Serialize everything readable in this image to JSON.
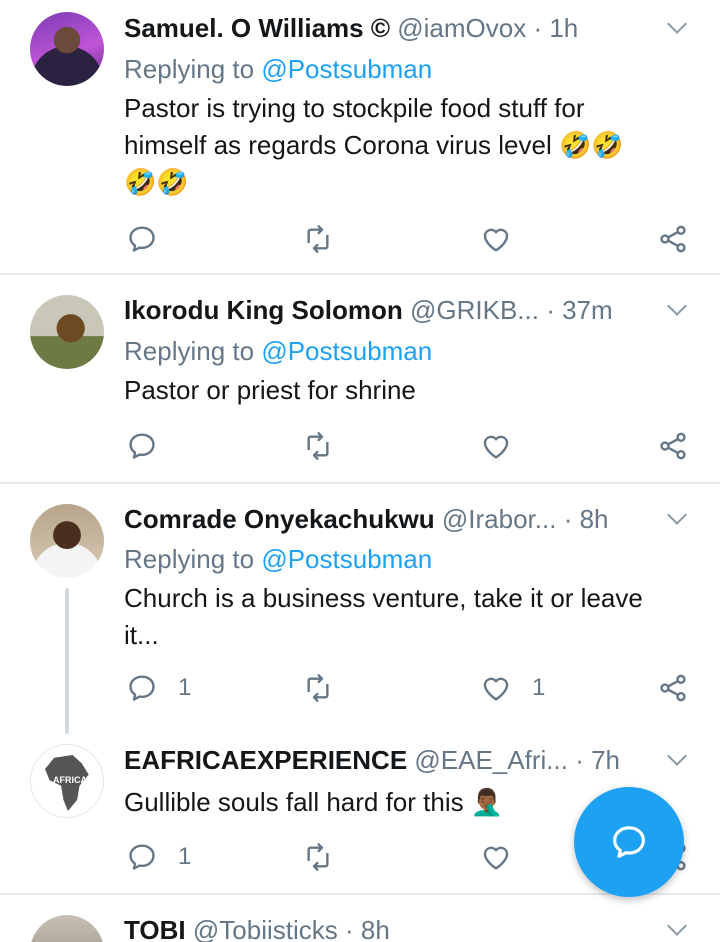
{
  "tweets": [
    {
      "name": "Samuel. O Williams ©",
      "handle": "@iamOvox",
      "time": "· 1h",
      "reply_prefix": "Replying to",
      "reply_to": "@Postsubman",
      "text": "Pastor is trying to stockpile food stuff for himself as regards Corona virus level 🤣🤣\n🤣🤣",
      "replies": "",
      "likes": ""
    },
    {
      "name": "Ikorodu King Solomon",
      "handle": "@GRIKB...",
      "time": "· 37m",
      "reply_prefix": "Replying to",
      "reply_to": "@Postsubman",
      "text": "Pastor or priest for shrine",
      "replies": "",
      "likes": ""
    },
    {
      "name": "Comrade Onyekachukwu",
      "handle": "@Irabor...",
      "time": "· 8h",
      "reply_prefix": "Replying to",
      "reply_to": "@Postsubman",
      "text": "Church is a business venture, take it or leave it...",
      "replies": "1",
      "likes": "1"
    },
    {
      "name": "EAFRICAEXPERIENCE",
      "handle": "@EAE_Afri...",
      "time": "· 7h",
      "text": "Gullible souls fall hard for this 🤦🏾‍♂️",
      "replies": "1",
      "likes": "",
      "avatar_text": "AFRICA"
    },
    {
      "name": "TOBI",
      "handle": "@Tobiisticks",
      "time": "· 8h"
    }
  ],
  "icons": {
    "reply": "comment-icon",
    "retweet": "retweet-icon",
    "like": "heart-icon",
    "share": "share-icon",
    "menu": "chevron-down-icon",
    "compose": "compose-reply-icon"
  },
  "colors": {
    "accent": "#1da1f2",
    "muted": "#657786",
    "divider": "#e6ecf0"
  }
}
